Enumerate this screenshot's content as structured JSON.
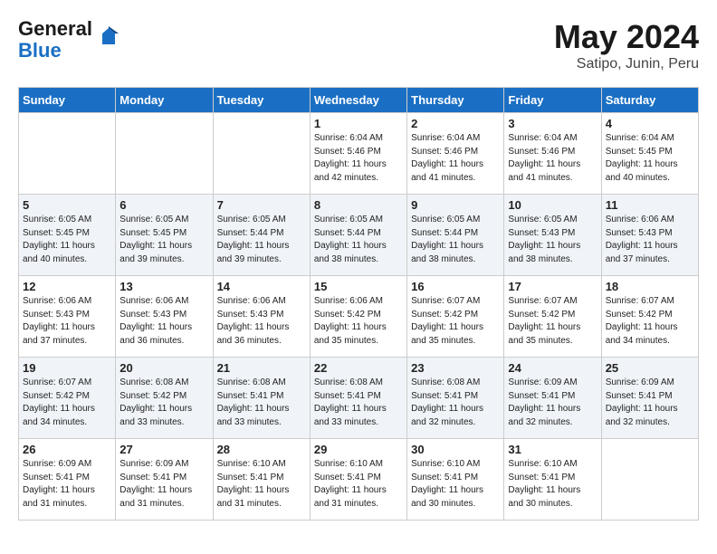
{
  "header": {
    "logo_line1": "General",
    "logo_line2": "Blue",
    "month": "May 2024",
    "location": "Satipo, Junin, Peru"
  },
  "weekdays": [
    "Sunday",
    "Monday",
    "Tuesday",
    "Wednesday",
    "Thursday",
    "Friday",
    "Saturday"
  ],
  "weeks": [
    [
      {
        "day": "",
        "info": ""
      },
      {
        "day": "",
        "info": ""
      },
      {
        "day": "",
        "info": ""
      },
      {
        "day": "1",
        "info": "Sunrise: 6:04 AM\nSunset: 5:46 PM\nDaylight: 11 hours\nand 42 minutes."
      },
      {
        "day": "2",
        "info": "Sunrise: 6:04 AM\nSunset: 5:46 PM\nDaylight: 11 hours\nand 41 minutes."
      },
      {
        "day": "3",
        "info": "Sunrise: 6:04 AM\nSunset: 5:46 PM\nDaylight: 11 hours\nand 41 minutes."
      },
      {
        "day": "4",
        "info": "Sunrise: 6:04 AM\nSunset: 5:45 PM\nDaylight: 11 hours\nand 40 minutes."
      }
    ],
    [
      {
        "day": "5",
        "info": "Sunrise: 6:05 AM\nSunset: 5:45 PM\nDaylight: 11 hours\nand 40 minutes."
      },
      {
        "day": "6",
        "info": "Sunrise: 6:05 AM\nSunset: 5:45 PM\nDaylight: 11 hours\nand 39 minutes."
      },
      {
        "day": "7",
        "info": "Sunrise: 6:05 AM\nSunset: 5:44 PM\nDaylight: 11 hours\nand 39 minutes."
      },
      {
        "day": "8",
        "info": "Sunrise: 6:05 AM\nSunset: 5:44 PM\nDaylight: 11 hours\nand 38 minutes."
      },
      {
        "day": "9",
        "info": "Sunrise: 6:05 AM\nSunset: 5:44 PM\nDaylight: 11 hours\nand 38 minutes."
      },
      {
        "day": "10",
        "info": "Sunrise: 6:05 AM\nSunset: 5:43 PM\nDaylight: 11 hours\nand 38 minutes."
      },
      {
        "day": "11",
        "info": "Sunrise: 6:06 AM\nSunset: 5:43 PM\nDaylight: 11 hours\nand 37 minutes."
      }
    ],
    [
      {
        "day": "12",
        "info": "Sunrise: 6:06 AM\nSunset: 5:43 PM\nDaylight: 11 hours\nand 37 minutes."
      },
      {
        "day": "13",
        "info": "Sunrise: 6:06 AM\nSunset: 5:43 PM\nDaylight: 11 hours\nand 36 minutes."
      },
      {
        "day": "14",
        "info": "Sunrise: 6:06 AM\nSunset: 5:43 PM\nDaylight: 11 hours\nand 36 minutes."
      },
      {
        "day": "15",
        "info": "Sunrise: 6:06 AM\nSunset: 5:42 PM\nDaylight: 11 hours\nand 35 minutes."
      },
      {
        "day": "16",
        "info": "Sunrise: 6:07 AM\nSunset: 5:42 PM\nDaylight: 11 hours\nand 35 minutes."
      },
      {
        "day": "17",
        "info": "Sunrise: 6:07 AM\nSunset: 5:42 PM\nDaylight: 11 hours\nand 35 minutes."
      },
      {
        "day": "18",
        "info": "Sunrise: 6:07 AM\nSunset: 5:42 PM\nDaylight: 11 hours\nand 34 minutes."
      }
    ],
    [
      {
        "day": "19",
        "info": "Sunrise: 6:07 AM\nSunset: 5:42 PM\nDaylight: 11 hours\nand 34 minutes."
      },
      {
        "day": "20",
        "info": "Sunrise: 6:08 AM\nSunset: 5:42 PM\nDaylight: 11 hours\nand 33 minutes."
      },
      {
        "day": "21",
        "info": "Sunrise: 6:08 AM\nSunset: 5:41 PM\nDaylight: 11 hours\nand 33 minutes."
      },
      {
        "day": "22",
        "info": "Sunrise: 6:08 AM\nSunset: 5:41 PM\nDaylight: 11 hours\nand 33 minutes."
      },
      {
        "day": "23",
        "info": "Sunrise: 6:08 AM\nSunset: 5:41 PM\nDaylight: 11 hours\nand 32 minutes."
      },
      {
        "day": "24",
        "info": "Sunrise: 6:09 AM\nSunset: 5:41 PM\nDaylight: 11 hours\nand 32 minutes."
      },
      {
        "day": "25",
        "info": "Sunrise: 6:09 AM\nSunset: 5:41 PM\nDaylight: 11 hours\nand 32 minutes."
      }
    ],
    [
      {
        "day": "26",
        "info": "Sunrise: 6:09 AM\nSunset: 5:41 PM\nDaylight: 11 hours\nand 31 minutes."
      },
      {
        "day": "27",
        "info": "Sunrise: 6:09 AM\nSunset: 5:41 PM\nDaylight: 11 hours\nand 31 minutes."
      },
      {
        "day": "28",
        "info": "Sunrise: 6:10 AM\nSunset: 5:41 PM\nDaylight: 11 hours\nand 31 minutes."
      },
      {
        "day": "29",
        "info": "Sunrise: 6:10 AM\nSunset: 5:41 PM\nDaylight: 11 hours\nand 31 minutes."
      },
      {
        "day": "30",
        "info": "Sunrise: 6:10 AM\nSunset: 5:41 PM\nDaylight: 11 hours\nand 30 minutes."
      },
      {
        "day": "31",
        "info": "Sunrise: 6:10 AM\nSunset: 5:41 PM\nDaylight: 11 hours\nand 30 minutes."
      },
      {
        "day": "",
        "info": ""
      }
    ]
  ]
}
